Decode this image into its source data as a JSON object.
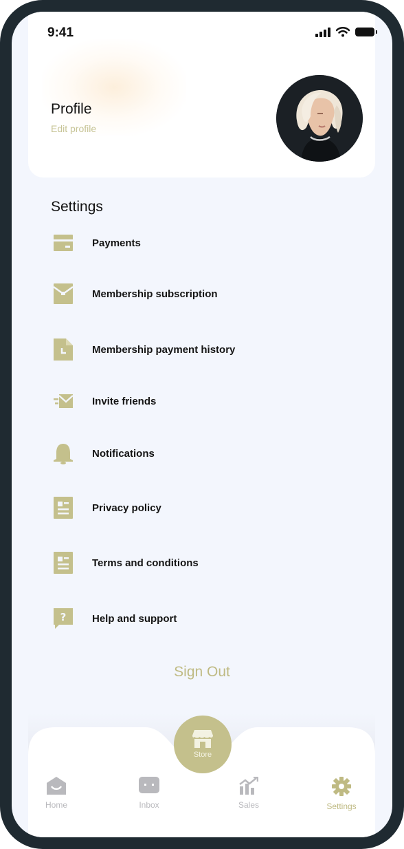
{
  "status_bar": {
    "time": "9:41"
  },
  "profile": {
    "title": "Profile",
    "edit_label": "Edit profile"
  },
  "settings": {
    "title": "Settings",
    "items": [
      {
        "label": "Payments",
        "icon": "card-icon"
      },
      {
        "label": "Membership subscription",
        "icon": "envelope-icon"
      },
      {
        "label": "Membership payment history",
        "icon": "document-clock-icon"
      },
      {
        "label": "Invite friends",
        "icon": "send-mail-icon"
      },
      {
        "label": "Notifications",
        "icon": "bell-icon"
      },
      {
        "label": "Privacy policy",
        "icon": "document-list-icon"
      },
      {
        "label": "Terms and conditions",
        "icon": "document-list-icon"
      },
      {
        "label": "Help and support",
        "icon": "help-chat-icon"
      }
    ]
  },
  "sign_out_label": "Sign Out",
  "tabbar": {
    "store_label": "Store",
    "tabs": [
      {
        "label": "Home",
        "icon": "home-icon",
        "active": false
      },
      {
        "label": "Inbox",
        "icon": "inbox-icon",
        "active": false
      },
      {
        "label": "Sales",
        "icon": "chart-icon",
        "active": false
      },
      {
        "label": "Settings",
        "icon": "gear-icon",
        "active": true
      }
    ]
  },
  "colors": {
    "accent": "#c4c08c",
    "accent_text": "#bfba83",
    "background": "#f3f6fd",
    "frame": "#1f2a31"
  }
}
